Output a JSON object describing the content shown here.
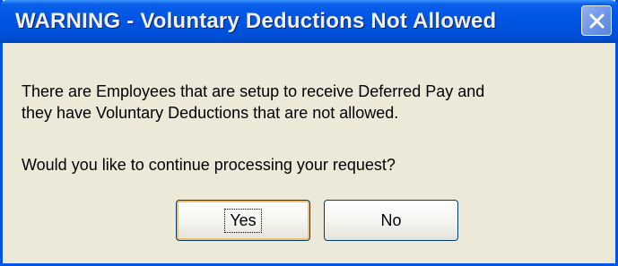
{
  "dialog": {
    "title": "WARNING - Voluntary Deductions Not Allowed",
    "message_line_1": "There are Employees that are setup to receive Deferred Pay and",
    "message_line_2": "they have Voluntary Deductions that are not allowed.",
    "question": "Would you like to continue processing your request?",
    "yes_label": "Yes",
    "no_label": "No",
    "close_icon": "close-icon"
  },
  "colors": {
    "titlebar": "#0055e5",
    "dialog_background": "#ece9d8",
    "button_focus_border": "#f0c070"
  }
}
